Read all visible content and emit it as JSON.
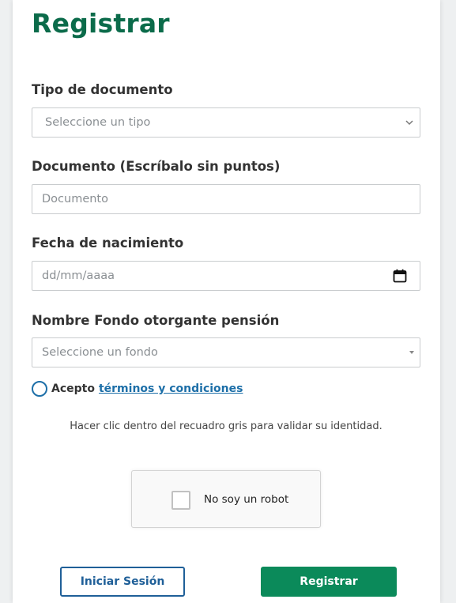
{
  "form": {
    "title": "Registrar",
    "doc_type": {
      "label": "Tipo de documento",
      "placeholder": "Seleccione un tipo"
    },
    "document": {
      "label": "Documento (Escríbalo sin puntos)",
      "placeholder": "Documento"
    },
    "birthdate": {
      "label": "Fecha de nacimiento",
      "placeholder": "dd/mm/aaaa"
    },
    "fund": {
      "label": "Nombre Fondo otorgante pensión",
      "placeholder": "Seleccione un fondo"
    },
    "terms": {
      "prefix": "Acepto",
      "link": "términos y condiciones"
    },
    "captcha_hint": "Hacer clic dentro del recuadro gris para validar su identidad.",
    "captcha_label": "No soy un robot",
    "login_button": "Iniciar Sesión",
    "register_button": "Registrar"
  },
  "icons": {
    "doc_type_arrow": "chevron-down-icon",
    "fund_arrow": "caret-down-icon",
    "birthdate_picker": "calendar-icon"
  },
  "colors": {
    "title": "#0b6b4a",
    "link": "#1d6fa8",
    "primary_button": "#0b8a5a",
    "secondary_button_border": "#1f5f98"
  }
}
